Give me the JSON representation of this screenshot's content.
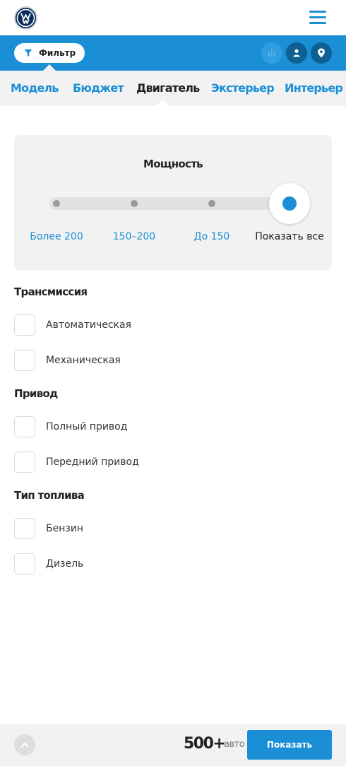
{
  "header": {
    "logo_icon": "volkswagen-logo-icon",
    "menu_icon": "hamburger-menu-icon"
  },
  "toolbar": {
    "filter_label": "Фильтр",
    "filter_icon": "funnel-icon",
    "icons": [
      "bar-chart-icon",
      "user-icon",
      "map-pin-icon"
    ]
  },
  "tabs": [
    {
      "label": "Модель",
      "active": false
    },
    {
      "label": "Бюджет",
      "active": false
    },
    {
      "label": "Двигатель",
      "active": true
    },
    {
      "label": "Экстерьер",
      "active": false
    },
    {
      "label": "Интерьер",
      "active": false
    }
  ],
  "power": {
    "title": "Мощность",
    "steps": [
      "Более 200",
      "150–200",
      "До 150",
      "Показать все"
    ],
    "selected_index": 3
  },
  "groups": [
    {
      "title": "Трансмиссия",
      "options": [
        {
          "label": "Автоматическая",
          "checked": false
        },
        {
          "label": "Механическая",
          "checked": false
        }
      ]
    },
    {
      "title": "Привод",
      "options": [
        {
          "label": "Полный привод",
          "checked": false
        },
        {
          "label": "Передний привод",
          "checked": false
        }
      ]
    },
    {
      "title": "Тип топлива",
      "options": [
        {
          "label": "Бензин",
          "checked": false
        },
        {
          "label": "Дизель",
          "checked": false
        }
      ]
    }
  ],
  "footer": {
    "count": "500+",
    "count_unit": "авто",
    "show_label": "Показать",
    "up_icon": "chevron-up-icon"
  },
  "colors": {
    "accent": "#1b8fd6",
    "accent_dark": "#0e5f92",
    "panel": "#f2f2f2",
    "text": "#222222"
  }
}
